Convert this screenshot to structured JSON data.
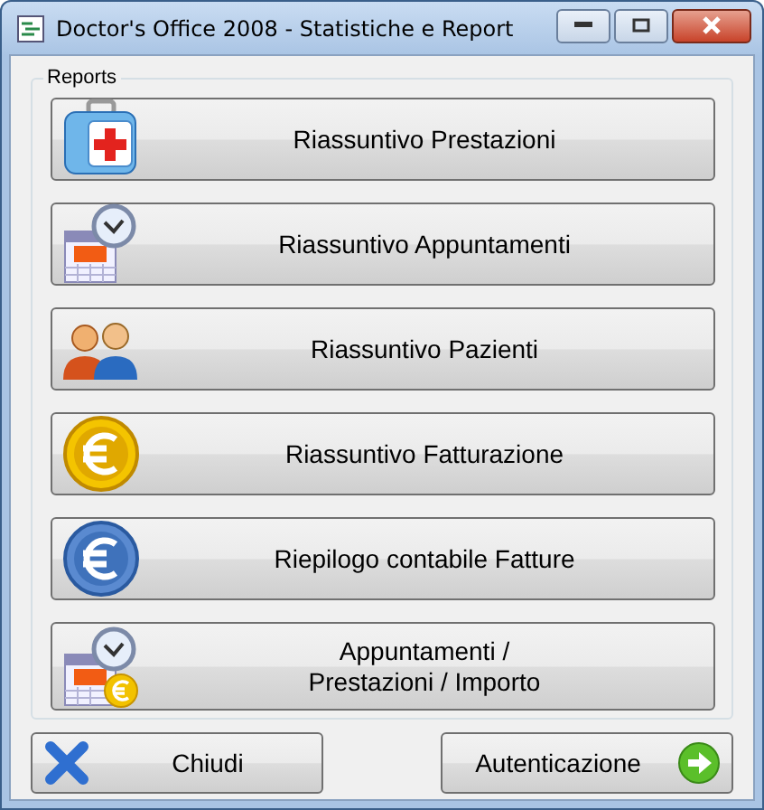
{
  "window": {
    "title": "Doctor's Office 2008 - Statistiche e Report"
  },
  "reports": {
    "label": "Reports",
    "buttons": [
      {
        "label": "Riassuntivo Prestazioni",
        "kind": "medkit"
      },
      {
        "label": "Riassuntivo Appuntamenti",
        "kind": "calendar"
      },
      {
        "label": "Riassuntivo Pazienti",
        "kind": "people"
      },
      {
        "label": "Riassuntivo Fatturazione",
        "kind": "gold-euro"
      },
      {
        "label": "Riepilogo contabile Fatture",
        "kind": "blue-euro"
      },
      {
        "label": "Appuntamenti /\nPrestazioni / Importo",
        "kind": "calendar-euro"
      }
    ]
  },
  "footer": [
    {
      "label": "Chiudi",
      "kind": "close"
    },
    {
      "label": "Autenticazione",
      "kind": "next"
    }
  ]
}
